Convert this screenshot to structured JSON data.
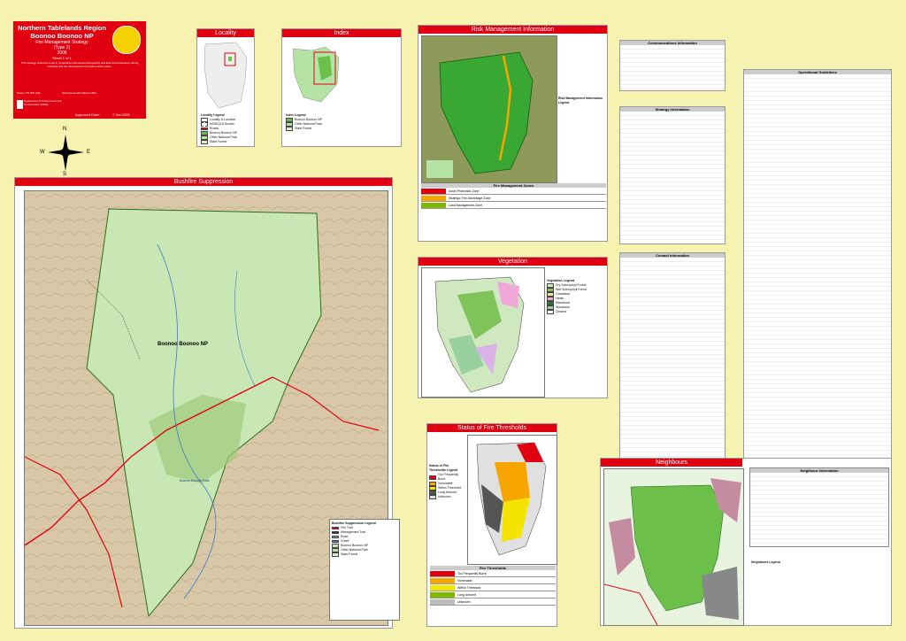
{
  "header": {
    "region": "Northern Tablelands Region",
    "park": "Boonoo Boonoo NP",
    "subtitle": "Fire Management Strategy",
    "type": "(Type 2)",
    "year": "2005",
    "sheet": "Sheet 1 of 1",
    "disclaimer": "This strategy should be used in conjunction with aerial photography and field reconnaissance during incidents and the development of incident action plans.",
    "scale": "Scale  1:70 000 (A0)",
    "datum": "GDA Geocentric Datum 1994",
    "approved_label": "Approved Date:",
    "approved_date": "7  Oct  2005",
    "dept": "Department of Environment and Conservation (NSW)"
  },
  "panels": {
    "locality": "Locality",
    "index": "Index",
    "risk": "Risk Management Information",
    "bushfire": "Bushfire Suppression",
    "vegetation": "Vegetation",
    "thresholds": "Status of Fire Thresholds",
    "neighbours": "Neighbours"
  },
  "legends": {
    "locality_title": "Locality Legend",
    "locality_items": [
      "Locality & Location",
      "NSW/QLD Border",
      "Roads",
      "Boonoo Boonoo NP",
      "Other National Park",
      "State Forest"
    ],
    "index_title": "Index Legend",
    "index_items": [
      "Boonoo Boonoo NP",
      "Other National Park",
      "State Forest"
    ],
    "risk_title": "Risk Management Information Legend",
    "veg_title": "Vegetation Legend",
    "veg_items": [
      "Dry Sclerophyll Forest",
      "Wet Sclerophyll Forest",
      "Grassland",
      "Heath",
      "Rainforest",
      "Woodland",
      "Cleared"
    ],
    "bushfire_title": "Bushfire Suppression Legend",
    "bushfire_items": [
      "Fire Trail",
      "Management Trail",
      "Road",
      "Creek",
      "Boonoo Boonoo NP",
      "Other National Park",
      "State Forest"
    ],
    "thresh_title": "Status of Fire Thresholds Legend",
    "thresh_items": [
      "Too Frequently Burnt",
      "Vulnerable",
      "Within Threshold",
      "Long Unburnt",
      "Unknown"
    ],
    "neigh_title": "Neighbours Legend"
  },
  "map_labels": {
    "park_name": "Boonoo Boonoo NP",
    "falls": "Boonoo Boonoo Falls"
  },
  "tables": {
    "comms_title": "Communications Information",
    "strategy_title": "Strategy Information",
    "ops_title": "Operational Guidelines",
    "contact_title": "Contact Information",
    "zones_title": "Fire Management Zones",
    "thresholds_title": "Fire Thresholds",
    "neigh_info_title": "Neighbour Information",
    "zones": [
      {
        "name": "Asset Protection Zone",
        "color": "#e1000f"
      },
      {
        "name": "Strategic Fire Advantage Zone",
        "color": "#f7a600"
      },
      {
        "name": "Land Management Zone",
        "color": "#7fb800"
      }
    ],
    "thresholds": [
      {
        "name": "Too Frequently Burnt",
        "color": "#e1000f"
      },
      {
        "name": "Vulnerable",
        "color": "#f7a600"
      },
      {
        "name": "Within Threshold",
        "color": "#f5e300"
      },
      {
        "name": "Long Unburnt",
        "color": "#7fb800"
      },
      {
        "name": "Unknown",
        "color": "#bdbdbd"
      }
    ]
  },
  "compass": {
    "n": "N",
    "s": "S",
    "e": "E",
    "w": "W"
  },
  "colors": {
    "accent": "#e1000f",
    "park": "#6cc04a",
    "other_park": "#b5e3a5",
    "state_forest": "#d9ecc6",
    "background": "#f6f2b0"
  }
}
